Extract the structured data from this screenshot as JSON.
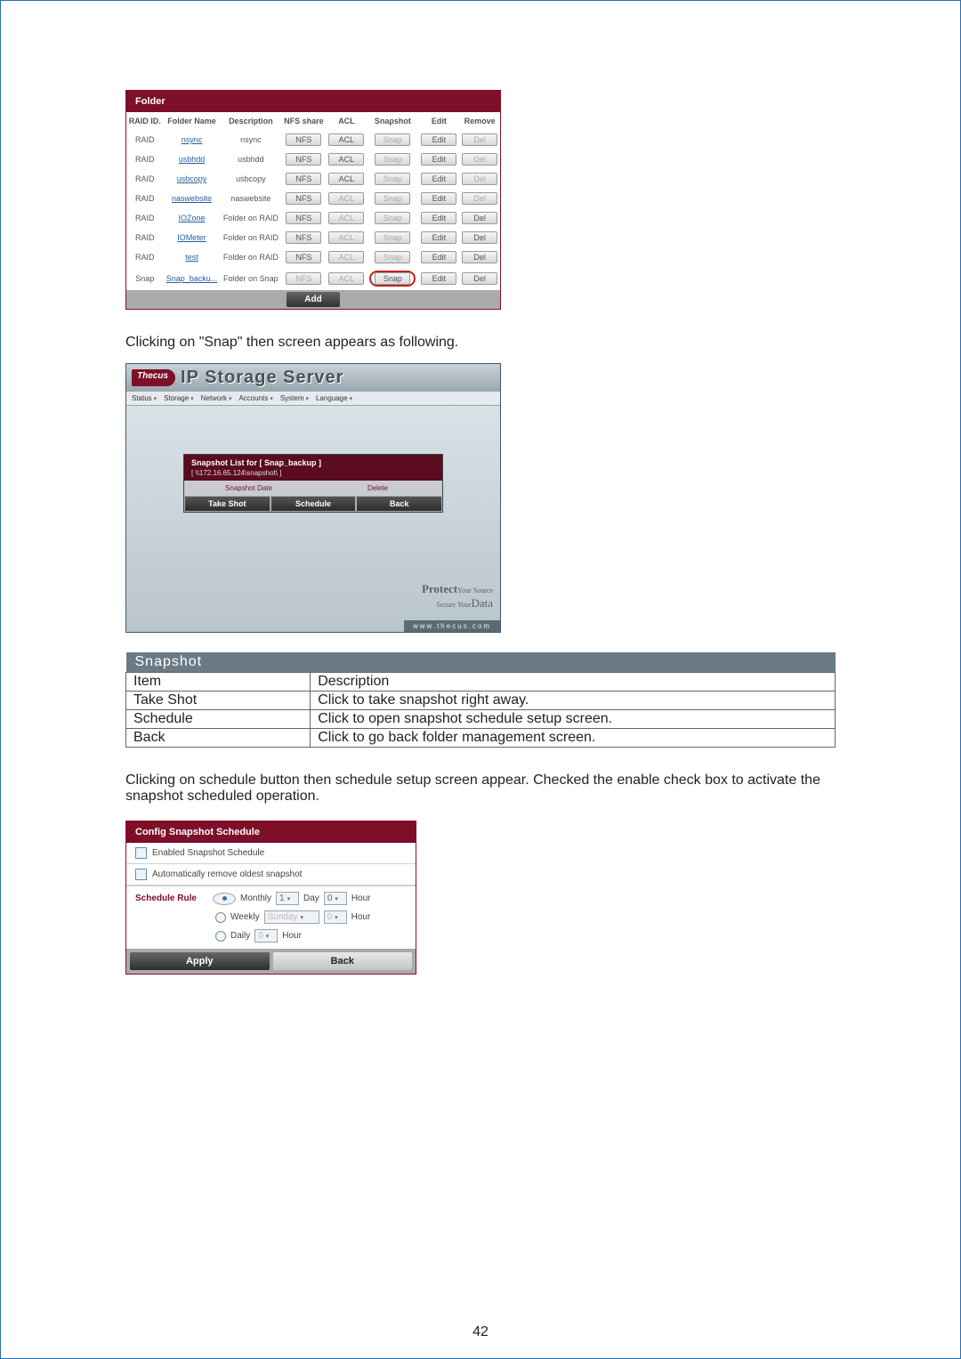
{
  "folder_panel": {
    "title": "Folder",
    "columns": [
      "RAID ID.",
      "Folder Name",
      "Description",
      "NFS share",
      "ACL",
      "Snapshot",
      "Edit",
      "Remove"
    ],
    "rows": [
      {
        "raid": "RAID",
        "name": "nsync",
        "desc": "nsync",
        "nfs": "NFS",
        "acl": "ACL",
        "snap": "Snap",
        "edit": "Edit",
        "del": "Del",
        "acl_on": true,
        "del_on": false,
        "circle": false
      },
      {
        "raid": "RAID",
        "name": "usbhdd",
        "desc": "usbhdd",
        "nfs": "NFS",
        "acl": "ACL",
        "snap": "Snap",
        "edit": "Edit",
        "del": "Del",
        "acl_on": true,
        "del_on": false,
        "circle": false
      },
      {
        "raid": "RAID",
        "name": "usbcopy",
        "desc": "usbcopy",
        "nfs": "NFS",
        "acl": "ACL",
        "snap": "Snap",
        "edit": "Edit",
        "del": "Del",
        "acl_on": true,
        "del_on": false,
        "circle": false
      },
      {
        "raid": "RAID",
        "name": "naswebsite",
        "desc": "naswebsite",
        "nfs": "NFS",
        "acl": "ACL",
        "snap": "Snap",
        "edit": "Edit",
        "del": "Del",
        "acl_on": false,
        "del_on": false,
        "circle": false
      },
      {
        "raid": "RAID",
        "name": "IOZone",
        "desc": "Folder on RAID",
        "nfs": "NFS",
        "acl": "ACL",
        "snap": "Snap",
        "edit": "Edit",
        "del": "Del",
        "acl_on": false,
        "del_on": true,
        "circle": false
      },
      {
        "raid": "RAID",
        "name": "IOMeter",
        "desc": "Folder on RAID",
        "nfs": "NFS",
        "acl": "ACL",
        "snap": "Snap",
        "edit": "Edit",
        "del": "Del",
        "acl_on": false,
        "del_on": true,
        "circle": false
      },
      {
        "raid": "RAID",
        "name": "test",
        "desc": "Folder on RAID",
        "nfs": "NFS",
        "acl": "ACL",
        "snap": "Snap",
        "edit": "Edit",
        "del": "Del",
        "acl_on": false,
        "del_on": true,
        "circle": false
      },
      {
        "raid": "Snap",
        "name": "Snap_backu...",
        "desc": "Folder on Snap",
        "nfs": "NFS",
        "acl": "ACL",
        "snap": "Snap",
        "edit": "Edit",
        "del": "Del",
        "acl_on": false,
        "del_on": true,
        "circle": true,
        "nfs_on": false
      }
    ],
    "add_label": "Add"
  },
  "text1": "Clicking on \"Snap\" then screen appears as following.",
  "ip_panel": {
    "logo": "Thecus",
    "title": "IP Storage Server",
    "menu": [
      "Status",
      "Storage",
      "Network",
      "Accounts",
      "System",
      "Language"
    ],
    "list_title": "Snapshot List for [ Snap_backup ]",
    "list_sub": "[ \\\\172.16.65.124\\snapshot\\ ]",
    "col_date": "Snapshot Date",
    "col_delete": "Delete",
    "btn_take": "Take Shot",
    "btn_schedule": "Schedule",
    "btn_back": "Back",
    "footer1": "Protect",
    "footer1b": "Your Source",
    "footer2": "Secure Your",
    "footer2b": "Data",
    "url": "www.thecus.com"
  },
  "desc_table": {
    "title": "Snapshot",
    "head_item": "Item",
    "head_desc": "Description",
    "rows": [
      {
        "item": "Take Shot",
        "desc": "Click to take snapshot right away."
      },
      {
        "item": "Schedule",
        "desc": "Click to open snapshot schedule setup screen."
      },
      {
        "item": "Back",
        "desc": "Click to go back folder management screen."
      }
    ]
  },
  "text2": "Clicking on schedule button then schedule setup screen appear. Checked the enable check box to activate the snapshot scheduled operation.",
  "cfg_panel": {
    "title": "Config Snapshot Schedule",
    "chk1": "Enabled Snapshot Schedule",
    "chk2": "Automatically remove oldest snapshot",
    "rule_label": "Schedule Rule",
    "monthly": "Monthly",
    "monthly_day_val": "1",
    "day": "Day",
    "monthly_hour_val": "0",
    "hour": "Hour",
    "weekly": "Weekly",
    "weekly_day_val": "Sunday",
    "weekly_hour_val": "0",
    "daily": "Daily",
    "daily_hour_val": "0",
    "apply": "Apply",
    "back": "Back"
  },
  "page_number": "42"
}
